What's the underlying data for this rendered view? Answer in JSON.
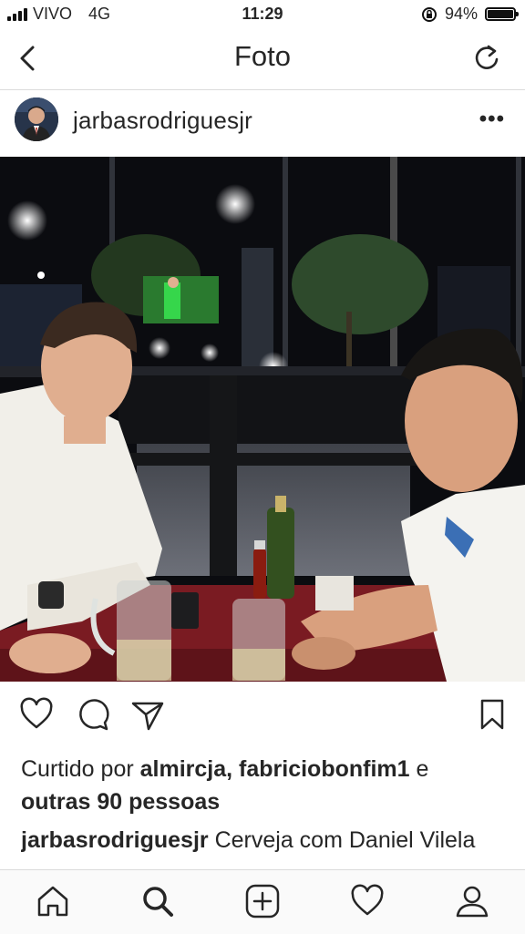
{
  "status_bar": {
    "carrier": "VIVO",
    "network": "4G",
    "time": "11:29",
    "battery": "94%",
    "battery_level": 0.94
  },
  "nav": {
    "title": "Foto",
    "back_icon": "chevron-left-icon",
    "refresh_icon": "refresh-icon"
  },
  "post": {
    "username": "jarbasrodriguesjr",
    "more_label": "•••",
    "photo_icon": "photo-two-men-at-table"
  },
  "likes": {
    "prefix": "Curtido por",
    "users": "almircja, fabriciobonfim1",
    "connector": "e",
    "others": "outras 90 pessoas"
  },
  "caption": {
    "username": "jarbasrodriguesjr",
    "text": "Cerveja com Daniel Vilela"
  },
  "colors": {
    "text": "#262626",
    "divider": "#dbdbdb",
    "tabbar_bg": "#fafafa"
  },
  "tabbar": [
    "home-icon",
    "search-icon",
    "add-post-icon",
    "activity-heart-icon",
    "profile-icon"
  ]
}
